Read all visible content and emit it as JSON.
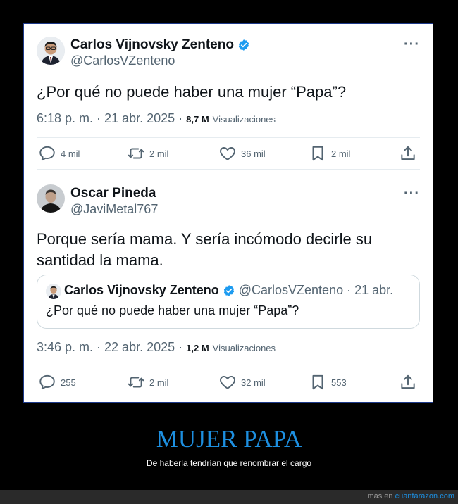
{
  "tweet1": {
    "name": "Carlos Vijnovsky Zenteno",
    "handle": "@CarlosVZenteno",
    "text": "¿Por qué no puede haber una mujer “Papa”?",
    "time": "6:18 p. m. · 21 abr. 2025 ·",
    "views_count": "8,7 M",
    "views_label": "Visualizaciones",
    "replies": "4 mil",
    "retweets": "2 mil",
    "likes": "36 mil",
    "bookmarks": "2 mil",
    "more": "···"
  },
  "tweet2": {
    "name": "Oscar Pineda",
    "handle": "@JaviMetal767",
    "text": "Porque sería mama. Y sería incómodo decirle su santidad la mama.",
    "time": "3:46 p. m. · 22 abr. 2025 ·",
    "views_count": "1,2 M",
    "views_label": "Visualizaciones",
    "replies": "255",
    "retweets": "2 mil",
    "likes": "32 mil",
    "bookmarks": "553",
    "more": "···"
  },
  "quote": {
    "name": "Carlos Vijnovsky Zenteno",
    "handle_date": "@CarlosVZenteno · 21 abr.",
    "text": "¿Por qué no puede haber una mujer “Papa”?"
  },
  "meme": {
    "title": "MUJER PAPA",
    "subtitle": "De haberla tendrían que renombrar el cargo"
  },
  "footer": {
    "prefix": "más en",
    "site": "cuantarazon.com"
  },
  "colors": {
    "verified": "#1d9bf0",
    "title": "#1d8fe0",
    "muted": "#536471"
  },
  "icons": [
    "reply-icon",
    "retweet-icon",
    "like-icon",
    "bookmark-icon",
    "share-icon",
    "verified-badge-icon",
    "more-icon"
  ]
}
